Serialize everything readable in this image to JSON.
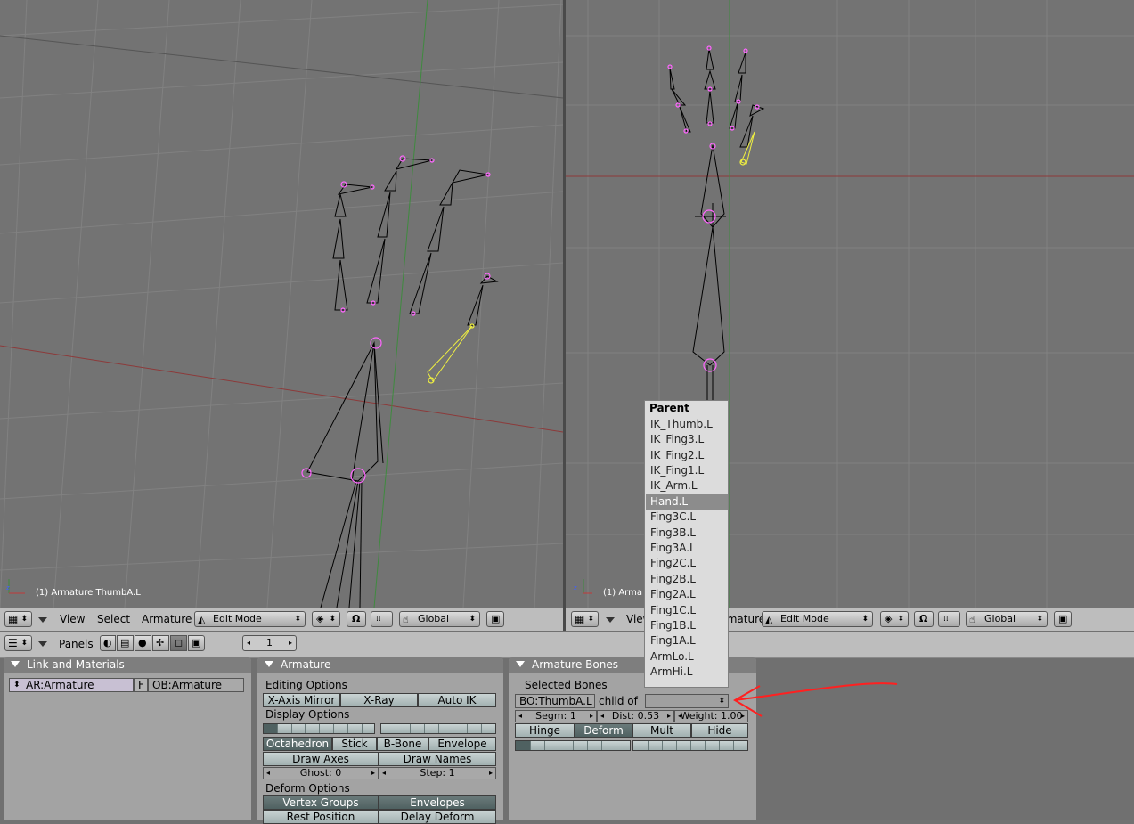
{
  "left_view": {
    "caption": "(1) Armature ThumbA.L"
  },
  "right_view": {
    "caption": "(1) Arma"
  },
  "left_header": {
    "menus": [
      "View",
      "Select",
      "Armature"
    ],
    "mode_label": "Edit Mode",
    "orientation_label": "Global"
  },
  "right_header": {
    "menus": [
      "View",
      "rmature"
    ],
    "mode_label": "Edit Mode",
    "orientation_label": "Global"
  },
  "buttons_header": {
    "panels_label": "Panels",
    "frame_value": "1"
  },
  "link_panel": {
    "title": "Link and Materials",
    "armature_name": "AR:Armature",
    "fake_user": "F",
    "object_name": "OB:Armature"
  },
  "armature_panel": {
    "title": "Armature",
    "editing_options_label": "Editing Options",
    "editing_buttons": [
      "X-Axis Mirror",
      "X-Ray",
      "Auto IK"
    ],
    "display_options_label": "Display Options",
    "display_buttons": [
      "Octahedron",
      "Stick",
      "B-Bone",
      "Envelope"
    ],
    "draw_axes": "Draw Axes",
    "draw_names": "Draw Names",
    "ghost": "Ghost: 0",
    "step": "Step: 1",
    "deform_options_label": "Deform Options",
    "vertex_groups": "Vertex Groups",
    "envelopes": "Envelopes",
    "rest_position": "Rest Position",
    "delay_deform": "Delay Deform"
  },
  "bones_panel": {
    "title": "Armature Bones",
    "selected_bones_label": "Selected Bones",
    "bone_name": "BO:ThumbA.L",
    "child_of_label": "child of",
    "segm": "Segm: 1",
    "dist": "Dist: 0.53",
    "weight": "Weight: 1.00",
    "flags": [
      "Hinge",
      "Deform",
      "Mult",
      "Hide"
    ]
  },
  "parent_menu": {
    "title": "Parent",
    "items": [
      "IK_Thumb.L",
      "IK_Fing3.L",
      "IK_Fing2.L",
      "IK_Fing1.L",
      "IK_Arm.L",
      "Hand.L",
      "Fing3C.L",
      "Fing3B.L",
      "Fing3A.L",
      "Fing2C.L",
      "Fing2B.L",
      "Fing2A.L",
      "Fing1C.L",
      "Fing1B.L",
      "Fing1A.L",
      "ArmLo.L",
      "ArmHi.L"
    ],
    "highlighted": "Hand.L"
  },
  "colors": {
    "viewport_bg": "#737373",
    "grid": "#818181",
    "x_axis": "#8c3a3a",
    "y_axis": "#3f8a3f",
    "bone_wire": "#000000",
    "selected_bone": "#f0f040",
    "joint": "#ff66ff",
    "annotation_arrow": "#ff2020",
    "panel_bg": "#a3a3a3"
  }
}
